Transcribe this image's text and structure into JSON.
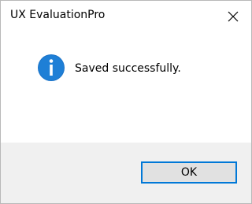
{
  "window": {
    "title": "UX EvaluationPro",
    "close_icon": "close-icon"
  },
  "message": {
    "icon": "info-icon",
    "text": "Saved successfully."
  },
  "buttons": {
    "ok_label": "OK"
  },
  "colors": {
    "accent": "#0078d7",
    "footer_bg": "#f0f0f0",
    "button_bg": "#e1e1e1"
  }
}
